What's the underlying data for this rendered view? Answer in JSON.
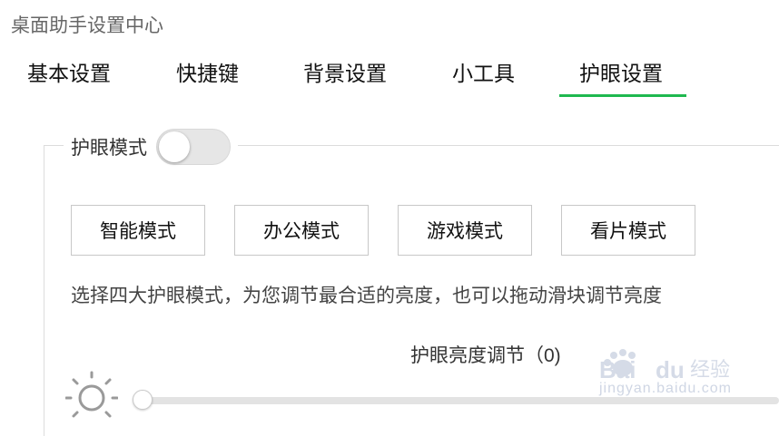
{
  "app": {
    "title": "桌面助手设置中心"
  },
  "tabs": [
    {
      "label": "基本设置"
    },
    {
      "label": "快捷键"
    },
    {
      "label": "背景设置"
    },
    {
      "label": "小工具"
    },
    {
      "label": "护眼设置"
    }
  ],
  "active_tab": "护眼设置",
  "accent_color": "#1fb84f",
  "eye_mode": {
    "label": "护眼模式",
    "toggle_on": false,
    "modes": [
      {
        "label": "智能模式"
      },
      {
        "label": "办公模式"
      },
      {
        "label": "游戏模式"
      },
      {
        "label": "看片模式"
      }
    ],
    "description": "选择四大护眼模式，为您调节最合适的亮度，也可以拖动滑块调节亮度",
    "brightness": {
      "label": "护眼亮度调节（0)",
      "value": 0,
      "icon": "sun-icon"
    }
  },
  "watermark": {
    "logo": "Baidu 经验",
    "url": "jingyan.baidu.com"
  }
}
